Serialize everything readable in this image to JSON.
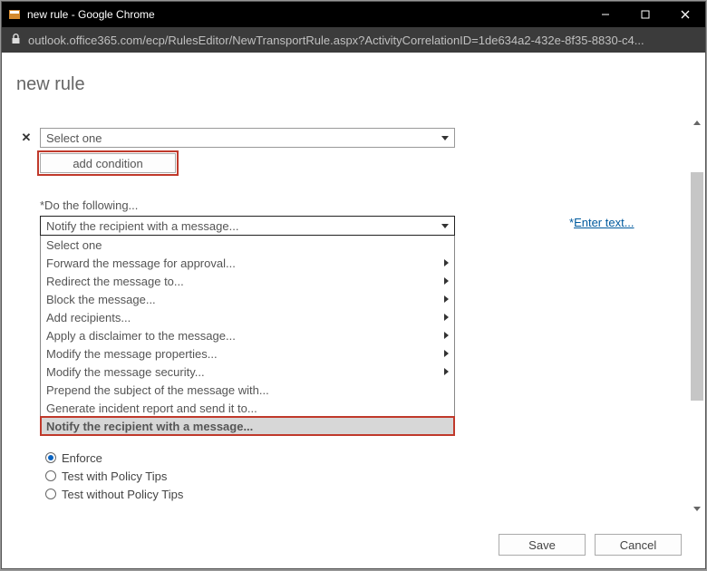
{
  "window": {
    "title": "new rule - Google Chrome"
  },
  "urlbar": {
    "url": "outlook.office365.com/ecp/RulesEditor/NewTransportRule.aspx?ActivityCorrelationID=1de634a2-432e-8f35-8830-c4..."
  },
  "page": {
    "title": "new rule"
  },
  "condition": {
    "placeholder": "Select one",
    "add_label": "add condition"
  },
  "action": {
    "section_label": "*Do the following...",
    "selected": "Notify the recipient with a message...",
    "enter_text_label": "Enter text...",
    "options": [
      {
        "label": "Select one",
        "submenu": false
      },
      {
        "label": "Forward the message for approval...",
        "submenu": true
      },
      {
        "label": "Redirect the message to...",
        "submenu": true
      },
      {
        "label": "Block the message...",
        "submenu": true
      },
      {
        "label": "Add recipients...",
        "submenu": true
      },
      {
        "label": "Apply a disclaimer to the message...",
        "submenu": true
      },
      {
        "label": "Modify the message properties...",
        "submenu": true
      },
      {
        "label": "Modify the message security...",
        "submenu": true
      },
      {
        "label": "Prepend the subject of the message with...",
        "submenu": false
      },
      {
        "label": "Generate incident report and send it to...",
        "submenu": false
      },
      {
        "label": "Notify the recipient with a message...",
        "submenu": false
      }
    ]
  },
  "mode": {
    "options": [
      {
        "label": "Enforce",
        "checked": true
      },
      {
        "label": "Test with Policy Tips",
        "checked": false
      },
      {
        "label": "Test without Policy Tips",
        "checked": false
      }
    ]
  },
  "footer": {
    "save": "Save",
    "cancel": "Cancel"
  }
}
